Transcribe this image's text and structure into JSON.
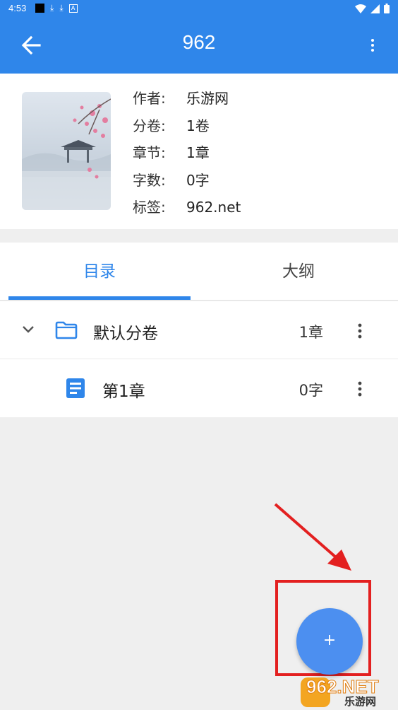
{
  "status_bar": {
    "time": "4:53"
  },
  "app_bar": {
    "title": "962"
  },
  "book_info": {
    "rows": [
      {
        "key": "作者:",
        "value": "乐游网"
      },
      {
        "key": "分卷:",
        "value": "1卷"
      },
      {
        "key": "章节:",
        "value": "1章"
      },
      {
        "key": "字数:",
        "value": "0字"
      },
      {
        "key": "标签:",
        "value": "962.net"
      }
    ]
  },
  "tabs": [
    {
      "label": "目录",
      "active": true
    },
    {
      "label": "大纲",
      "active": false
    }
  ],
  "volumes": [
    {
      "label": "默认分卷",
      "count": "1章",
      "icon": "folder-icon"
    }
  ],
  "chapters": [
    {
      "label": "第1章",
      "count": "0字",
      "icon": "document-icon"
    }
  ],
  "fab": {
    "label": "+"
  },
  "watermark": {
    "text": "962.NET",
    "sub": "乐游网"
  },
  "colors": {
    "primary": "#2f86ea",
    "fab": "#4c8ff0",
    "highlight": "#e32020"
  }
}
